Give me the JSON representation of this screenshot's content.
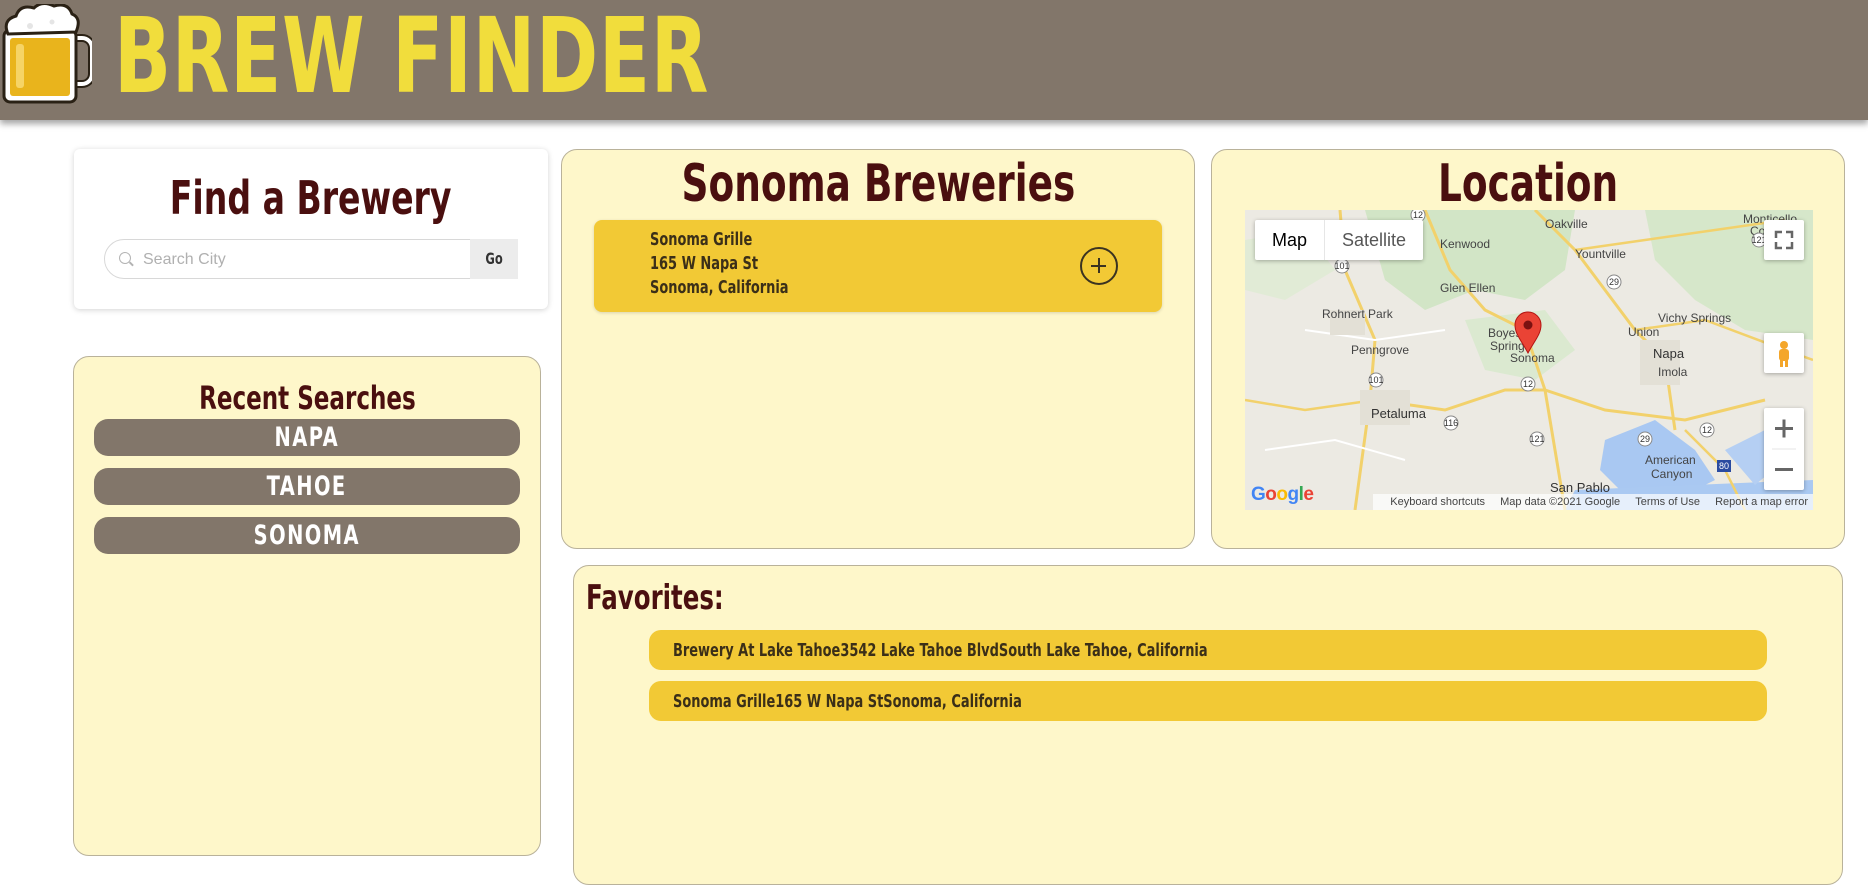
{
  "header": {
    "brand": "BREW FINDER",
    "logo_icon": "beer-mug-icon"
  },
  "find": {
    "title": "Find a Brewery",
    "search_placeholder": "Search City",
    "go_label": "Go"
  },
  "recent": {
    "title": "Recent Searches",
    "items": [
      "NAPA",
      "TAHOE",
      "SONOMA"
    ]
  },
  "breweries": {
    "title": "Sonoma Breweries",
    "items": [
      {
        "name": "Sonoma Grille",
        "street": "165 W Napa St",
        "city": "Sonoma, California"
      }
    ]
  },
  "location": {
    "title": "Location",
    "map": {
      "type_map": "Map",
      "type_satellite": "Satellite",
      "google": "Google",
      "attribution": [
        "Keyboard shortcuts",
        "Map data ©2021 Google",
        "Terms of Use",
        "Report a map error"
      ],
      "places": [
        "Oakville",
        "Kenwood",
        "Yountville",
        "Glen Ellen",
        "Rohnert Park",
        "Boyes Springs",
        "Sonoma",
        "Vichy Springs",
        "Union",
        "Napa",
        "Imola",
        "Penngrove",
        "Petaluma",
        "American Canyon",
        "San Pablo",
        "Monticello Corner"
      ],
      "highways": [
        "12",
        "101",
        "29",
        "121",
        "116",
        "80"
      ]
    }
  },
  "favorites": {
    "title": "Favorites:",
    "items": [
      "Brewery At Lake Tahoe3542 Lake Tahoe BlvdSouth Lake Tahoe, California",
      "Sonoma Grille165 W Napa StSonoma, California"
    ]
  },
  "colors": {
    "header_bg": "#82766a",
    "brand_yellow": "#f1dd3c",
    "panel_bg": "#fef7ca",
    "item_gold": "#f2c935",
    "title_maroon": "#4a0f0f"
  }
}
